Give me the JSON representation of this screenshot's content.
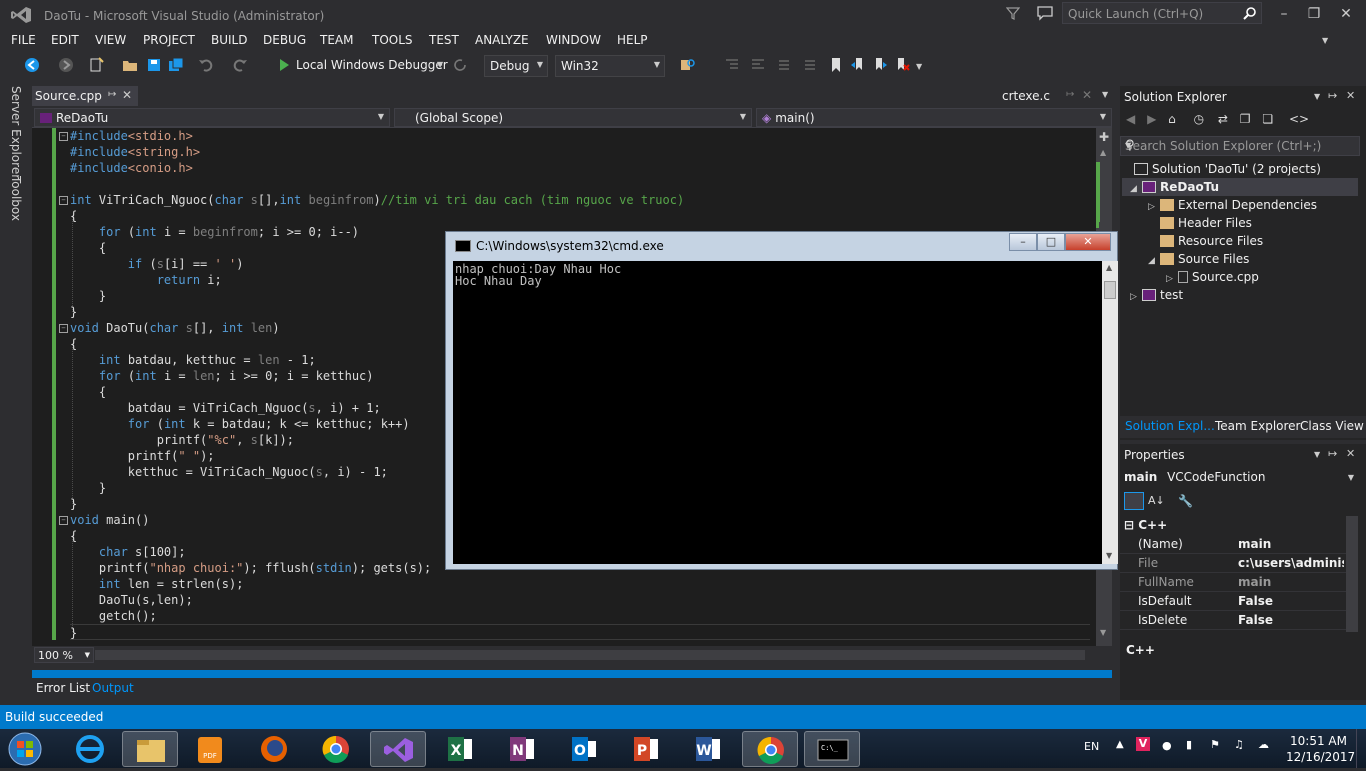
{
  "window": {
    "title": "DaoTu - Microsoft Visual Studio (Administrator)",
    "quick_launch_placeholder": "Quick Launch (Ctrl+Q)"
  },
  "menu": [
    "FILE",
    "EDIT",
    "VIEW",
    "PROJECT",
    "BUILD",
    "DEBUG",
    "TEAM",
    "TOOLS",
    "TEST",
    "ANALYZE",
    "WINDOW",
    "HELP"
  ],
  "toolbar": {
    "debugger_label": "Local Windows Debugger",
    "config": "Debug",
    "platform": "Win32"
  },
  "left_tabs": [
    "Server Explorer",
    "Toolbox"
  ],
  "editor": {
    "active_tab": "Source.cpp",
    "right_tab": "crtexe.c",
    "nav_project": "ReDaoTu",
    "nav_scope": "(Global Scope)",
    "nav_member": "main()",
    "zoom": "100 %",
    "lines": [
      "#include<stdio.h>",
      "#include<string.h>",
      "#include<conio.h>",
      "",
      "int ViTriCach_Nguoc(char s[],int beginfrom)//tim vi tri dau cach (tim nguoc ve truoc)",
      "{",
      "    for (int i = beginfrom; i >= 0; i--)",
      "    {",
      "        if (s[i] == ' ')",
      "            return i;",
      "    }",
      "}",
      "void DaoTu(char s[], int len)",
      "{",
      "    int batdau, ketthuc = len - 1;",
      "    for (int i = len; i >= 0; i = ketthuc)",
      "    {",
      "        batdau = ViTriCach_Nguoc(s, i) + 1;",
      "        for (int k = batdau; k <= ketthuc; k++)",
      "            printf(\"%c\", s[k]);",
      "        printf(\" \");",
      "        ketthuc = ViTriCach_Nguoc(s, i) - 1;",
      "    }",
      "}",
      "void main()",
      "{",
      "    char s[100];",
      "    printf(\"nhap chuoi:\"); fflush(stdin); gets(s);",
      "    int len = strlen(s);",
      "    DaoTu(s,len);",
      "    getch();",
      "}"
    ]
  },
  "bottom_tabs": [
    "Error List",
    "Output"
  ],
  "solution_explorer": {
    "title": "Solution Explorer",
    "search_placeholder": "Search Solution Explorer (Ctrl+;)",
    "solution": "Solution 'DaoTu' (2 projects)",
    "project": "ReDaoTu",
    "folders": [
      "External Dependencies",
      "Header Files",
      "Resource Files",
      "Source Files"
    ],
    "source_file": "Source.cpp",
    "other_project": "test",
    "tabs": [
      "Solution Expl...",
      "Team Explorer",
      "Class View"
    ]
  },
  "properties": {
    "title": "Properties",
    "object_name": "main",
    "object_type": "VCCodeFunction",
    "category": "C++",
    "rows": [
      {
        "k": "(Name)",
        "v": "main"
      },
      {
        "k": "File",
        "v": "c:\\users\\administra"
      },
      {
        "k": "FullName",
        "v": "main"
      },
      {
        "k": "IsDefault",
        "v": "False"
      },
      {
        "k": "IsDelete",
        "v": "False"
      }
    ],
    "description": "C++"
  },
  "cmd": {
    "title": "C:\\Windows\\system32\\cmd.exe",
    "output": [
      "nhap chuoi:Day Nhau Hoc",
      "Hoc Nhau Day"
    ]
  },
  "status": "Build succeeded",
  "tray": {
    "lang": "EN",
    "time": "10:51 AM",
    "date": "12/16/2017"
  },
  "colors": {
    "accent": "#007acc",
    "keyword": "#569cd6",
    "string": "#d69d85",
    "comment": "#57a64a"
  }
}
